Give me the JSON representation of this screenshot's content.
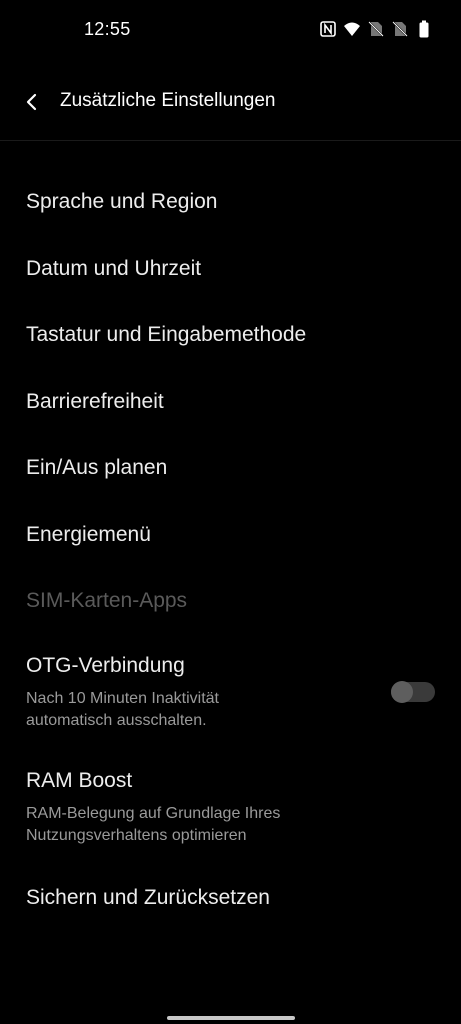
{
  "status_bar": {
    "time": "12:55",
    "icons": [
      "nfc-icon",
      "wifi-icon",
      "no-sim-icon",
      "no-sim-icon",
      "battery-icon"
    ]
  },
  "header": {
    "back_icon": "chevron-left-icon",
    "title": "Zusätzliche Einstellungen"
  },
  "settings": {
    "language_region": "Sprache und Region",
    "date_time": "Datum und Uhrzeit",
    "keyboard_input": "Tastatur und Eingabemethode",
    "accessibility": "Barrierefreiheit",
    "schedule_power": "Ein/Aus planen",
    "power_menu": "Energiemenü",
    "sim_apps": "SIM-Karten-Apps",
    "otg": {
      "title": "OTG-Verbindung",
      "subtitle_line1": "Nach 10 Minuten Inaktivität",
      "subtitle_line2": "automatisch ausschalten.",
      "enabled": false
    },
    "ram_boost": {
      "title": "RAM Boost",
      "subtitle_line1": "RAM-Belegung auf Grundlage Ihres",
      "subtitle_line2": "Nutzungsverhaltens optimieren"
    },
    "backup_reset": "Sichern und Zurücksetzen"
  },
  "colors": {
    "background": "#000000",
    "text_primary": "#ededed",
    "text_secondary": "#9a9a9a",
    "text_disabled": "#5a5a5a",
    "toggle_off_track": "#3a3a3a",
    "toggle_off_knob": "#5e5e5e"
  }
}
